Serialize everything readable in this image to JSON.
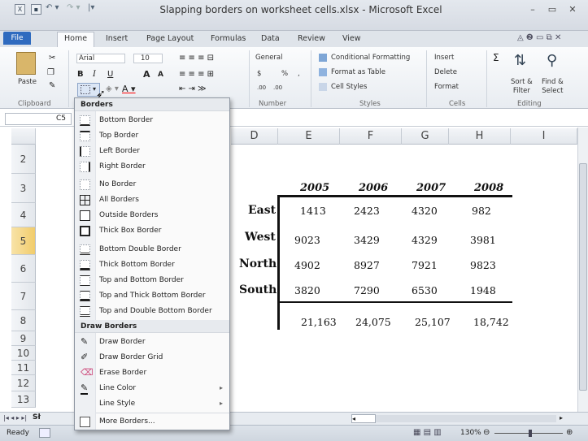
{
  "window": {
    "title": "Slapping borders on worksheet cells.xlsx - Microsoft Excel"
  },
  "tabs": [
    "File",
    "Home",
    "Insert",
    "Page Layout",
    "Formulas",
    "Data",
    "Review",
    "View"
  ],
  "ribbon": {
    "clipboard": {
      "paste": "Paste",
      "label": "Clipboard"
    },
    "font": {
      "name": "Arial",
      "size": "10",
      "bold": "B",
      "italic": "I",
      "underline": "U",
      "grow": "A",
      "shrink": "A"
    },
    "number": {
      "format": "General",
      "currency": "$",
      "percent": "%",
      "comma": ",",
      "inc_decimal": ".00",
      "dec_decimal": ".00",
      "label": "Number"
    },
    "styles": {
      "conditional": "Conditional Formatting",
      "table": "Format as Table",
      "cell_styles": "Cell Styles",
      "label": "Styles"
    },
    "cells": {
      "insert": "Insert",
      "delete": "Delete",
      "format": "Format",
      "label": "Cells"
    },
    "editing": {
      "sigma": "Σ",
      "sort": "Sort &",
      "filter": "Filter",
      "find": "Find &",
      "select": "Select",
      "label": "Editing"
    }
  },
  "formula_bar": {
    "name_box": "C5"
  },
  "columns": [
    "D",
    "E",
    "F",
    "G",
    "H",
    "I"
  ],
  "rows": [
    "2",
    "3",
    "4",
    "5",
    "6",
    "7",
    "8",
    "9",
    "10",
    "11",
    "12",
    "13"
  ],
  "table": {
    "years": [
      "2005",
      "2006",
      "2007",
      "2008"
    ],
    "regions": [
      {
        "name": "East",
        "values": [
          "1413",
          "2423",
          "4320",
          "982"
        ]
      },
      {
        "name": "West",
        "values": [
          "9023",
          "3429",
          "4329",
          "3981"
        ]
      },
      {
        "name": "North",
        "values": [
          "4902",
          "8927",
          "7921",
          "9823"
        ]
      },
      {
        "name": "South",
        "values": [
          "3820",
          "7290",
          "6530",
          "1948"
        ]
      }
    ],
    "totals": [
      "21,163",
      "24,075",
      "25,107",
      "18,742"
    ]
  },
  "menu": {
    "borders_header": "Borders",
    "items": [
      "Bottom Border",
      "Top Border",
      "Left Border",
      "Right Border",
      "No Border",
      "All Borders",
      "Outside Borders",
      "Thick Box Border",
      "Bottom Double Border",
      "Thick Bottom Border",
      "Top and Bottom Border",
      "Top and Thick Bottom Border",
      "Top and Double Bottom Border"
    ],
    "draw_header": "Draw Borders",
    "draw_items": [
      "Draw Border",
      "Draw Border Grid",
      "Erase Border",
      "Line Color",
      "Line Style"
    ],
    "more": "More Borders..."
  },
  "sheet_tab": "Sł",
  "status": {
    "ready": "Ready",
    "zoom": "130%"
  }
}
